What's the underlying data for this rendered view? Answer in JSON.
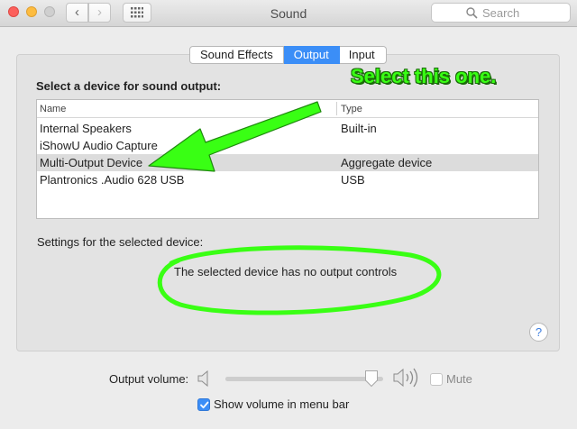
{
  "window": {
    "title": "Sound",
    "search_placeholder": "Search"
  },
  "tabs": [
    {
      "label": "Sound Effects",
      "active": false
    },
    {
      "label": "Output",
      "active": true
    },
    {
      "label": "Input",
      "active": false
    }
  ],
  "output": {
    "heading": "Select a device for sound output:",
    "columns": {
      "name": "Name",
      "type": "Type"
    },
    "devices": [
      {
        "name": "Internal Speakers",
        "type": "Built-in",
        "selected": false
      },
      {
        "name": "iShowU Audio Capture",
        "type": "",
        "selected": false
      },
      {
        "name": "Multi-Output Device",
        "type": "Aggregate device",
        "selected": true
      },
      {
        "name": "Plantronics .Audio 628 USB",
        "type": "USB",
        "selected": false
      }
    ],
    "settings_label": "Settings for the selected device:",
    "no_controls_message": "The selected device has no output controls"
  },
  "help": {
    "symbol": "?"
  },
  "volume": {
    "label": "Output volume:",
    "level": 0.97,
    "mute_label": "Mute",
    "mute_checked": false,
    "mute_enabled": false,
    "show_in_menubar_label": "Show volume in menu bar",
    "show_in_menubar_checked": true
  },
  "annotation": {
    "callout_text": "Select this one.",
    "color": "#39ff14"
  }
}
